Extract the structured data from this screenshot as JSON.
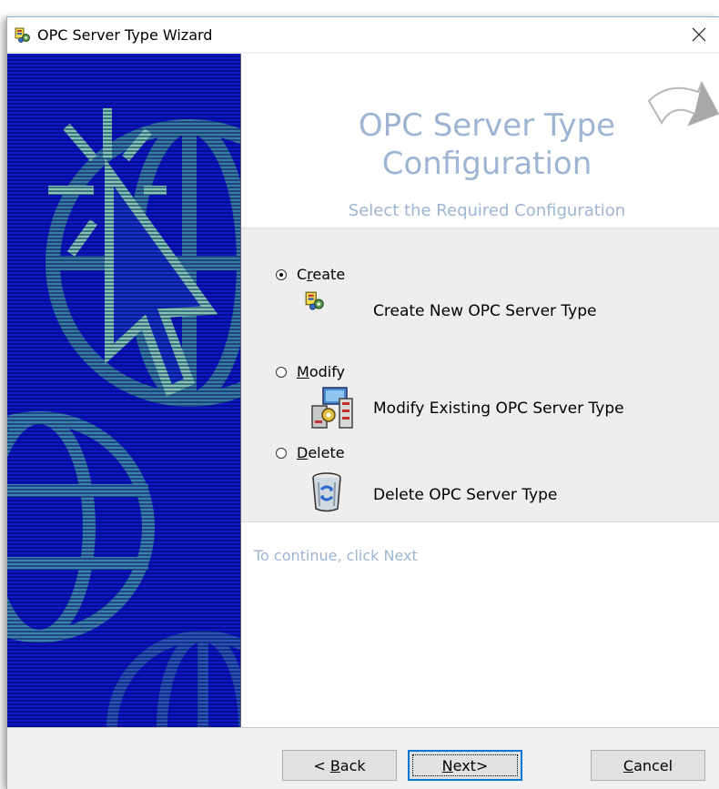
{
  "window": {
    "title": "OPC Server Type Wizard"
  },
  "header": {
    "title_line1": "OPC Server Type",
    "title_line2": "Configuration",
    "subtitle": "Select the Required Configuration"
  },
  "options": [
    {
      "label": "Create",
      "mnemonic_prefix": "C",
      "mnemonic": "r",
      "mnemonic_suffix": "eate",
      "description": "Create New OPC Server Type",
      "checked": true
    },
    {
      "label": "Modify",
      "mnemonic_prefix": "",
      "mnemonic": "M",
      "mnemonic_suffix": "odify",
      "description": "Modify Existing OPC Server Type",
      "checked": false
    },
    {
      "label": "Delete",
      "mnemonic_prefix": "",
      "mnemonic": "D",
      "mnemonic_suffix": "elete",
      "description": "Delete OPC Server Type",
      "checked": false
    }
  ],
  "hint": "To continue, click Next",
  "buttons": {
    "back_prefix": "< ",
    "back_mnemonic": "B",
    "back_suffix": "ack",
    "next_mnemonic": "N",
    "next_suffix": "ext>",
    "cancel_mnemonic": "C",
    "cancel_suffix": "ancel"
  },
  "colors": {
    "banner_blue": "#0a18c8",
    "banner_accent": "#5fb0a8",
    "header_text": "#9db5d2",
    "default_button_border": "#0078d7"
  },
  "icons": {
    "title": "wizard-gear-icon",
    "close": "close-icon",
    "create": "wizard-gear-icon",
    "modify": "server-modify-icon",
    "delete": "recycle-bin-icon",
    "header_arrow": "curved-arrow-icon"
  }
}
